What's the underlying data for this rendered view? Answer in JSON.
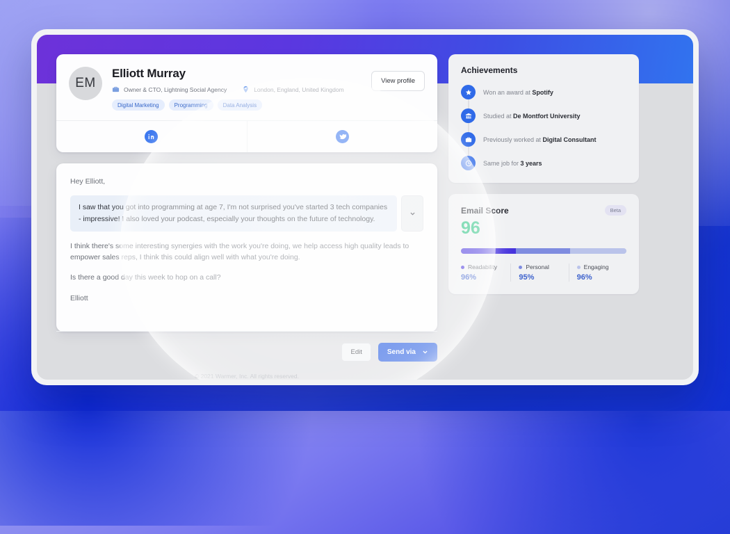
{
  "background": {
    "gradient_from": "#9a9ff0",
    "gradient_to": "#0b2bd0"
  },
  "window": {
    "header_gradient_from": "#6d32d9",
    "header_gradient_to": "#3173ef"
  },
  "profile": {
    "avatar_initials": "EM",
    "name": "Elliott Murray",
    "role_icon": "briefcase-icon",
    "role": "Owner & CTO, Lightning Social Agency",
    "location_icon": "map-pin-icon",
    "location": "London, England, United Kingdom",
    "tags": [
      "Digital Marketing",
      "Programming",
      "Data Analysis"
    ],
    "view_profile_label": "View profile",
    "socials": [
      {
        "icon": "linkedin-icon",
        "name": "LinkedIn"
      },
      {
        "icon": "twitter-icon",
        "name": "Twitter"
      }
    ]
  },
  "email": {
    "greeting": "Hey Elliott,",
    "highlighted_paragraph": "I saw that you got into programming at age 7, I'm not surprised you've started 3 tech companies - impressive! I also loved your podcast, especially your thoughts on the future of technology.",
    "highlight_chevron_icon": "chevron-down-icon",
    "paragraph_2": "I think there's some interesting synergies with the work you're doing, we help access high quality leads to empower sales reps, I think this could align well with what you're doing.",
    "paragraph_3": "Is there a good day this week to hop on a call?",
    "signoff": "Elliott",
    "edit_label": "Edit",
    "send_label": "Send via",
    "send_chevron_icon": "chevron-down-icon",
    "accent_color": "#1a53e0"
  },
  "footer": {
    "copyright": "© 2021 Warmer, Inc. All rights reserved."
  },
  "achievements": {
    "title": "Achievements",
    "items": [
      {
        "icon": "star-icon",
        "prefix": "Won an award at ",
        "highlight": "Spotify"
      },
      {
        "icon": "bank-icon",
        "prefix": "Studied at ",
        "highlight": "De Montfort University"
      },
      {
        "icon": "briefcase-icon",
        "prefix": "Previously worked at ",
        "highlight": "Digital Consultant"
      },
      {
        "icon": "clock-icon",
        "prefix": "Same job for ",
        "highlight": "3 years"
      }
    ]
  },
  "email_score": {
    "title": "Email Score",
    "badge": "Beta",
    "score": "96",
    "score_color": "#23c17e",
    "bar_segments": [
      {
        "label": "Readability",
        "value": "96%",
        "color": "#4733dd",
        "width_pct": 33
      },
      {
        "label": "Personal",
        "value": "95%",
        "color": "#7f8ce0",
        "width_pct": 33
      },
      {
        "label": "Engaging",
        "value": "96%",
        "color": "#bac3ea",
        "width_pct": 33
      }
    ]
  }
}
